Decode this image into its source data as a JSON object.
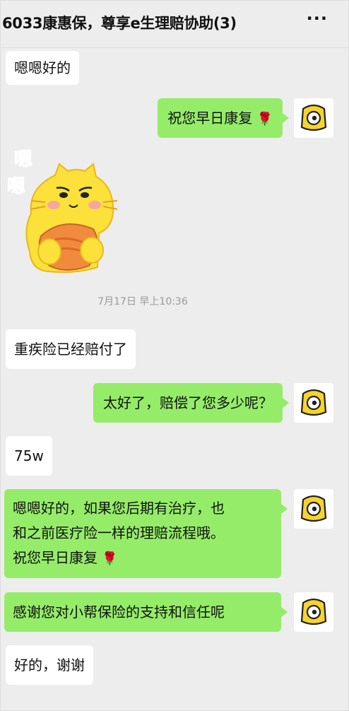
{
  "header": {
    "title": "6033康惠保，尊享e生理赔协助(3)",
    "more_label": "···"
  },
  "sticker": {
    "text_top": "嗯",
    "text_bottom": "嗯"
  },
  "timestamp": "7月17日 早上10:36",
  "messages": [
    {
      "side": "left",
      "text": "嗯嗯好的"
    },
    {
      "side": "right",
      "text": "祝您早日康复",
      "emoji": "🌹"
    },
    {
      "side": "left",
      "text": "重疾险已经赔付了"
    },
    {
      "side": "right",
      "text": "太好了，赔偿了您多少呢？"
    },
    {
      "side": "left",
      "text": "75w"
    },
    {
      "side": "right",
      "lines": [
        "嗯嗯好的，如果您后期有治疗，也",
        "和之前医疗险一样的理赔流程哦。",
        "祝您早日康复"
      ],
      "emoji": "🌹"
    },
    {
      "side": "right",
      "text": "感谢您对小帮保险的支持和信任呢"
    },
    {
      "side": "left",
      "text": "好的，谢谢"
    }
  ],
  "colors": {
    "background": "#ededed",
    "bubble_right": "#95ec69",
    "bubble_left": "#ffffff",
    "avatar_icon": "#f6d42c"
  },
  "avatar_icon": "cyclops-face-icon"
}
